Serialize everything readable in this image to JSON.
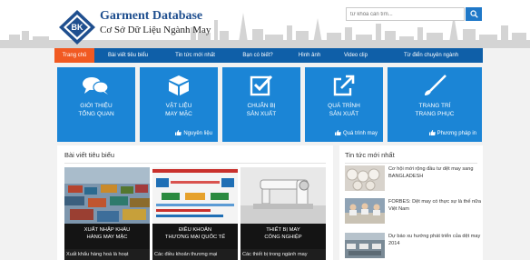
{
  "header": {
    "logo_text": "BK",
    "title": "Garment Database",
    "subtitle": "Cơ Sở Dữ Liệu Ngành May",
    "search_placeholder": "từ khóa cần tìm...",
    "search_icon": "search-icon"
  },
  "colors": {
    "nav_bg": "#0f5fa8",
    "nav_active": "#f15a22",
    "tile_bg": "#1b85d6",
    "title_blue": "#1f4f8f"
  },
  "nav": {
    "items": [
      {
        "label": "Trang chủ",
        "active": true
      },
      {
        "label": "Bài viết tiêu biểu",
        "active": false
      },
      {
        "label": "Tin tức mới nhất",
        "active": false
      },
      {
        "label": "Bạn có biết?",
        "active": false
      },
      {
        "label": "Hình ảnh",
        "active": false
      },
      {
        "label": "Video clip",
        "active": false
      },
      {
        "label": "Từ điển chuyên ngành",
        "active": false
      }
    ]
  },
  "tiles": [
    {
      "title_line1": "Giới thiệu",
      "title_line2": "tổng quan",
      "link": "",
      "icon": "chat-bubbles-icon"
    },
    {
      "title_line1": "Vật liệu",
      "title_line2": "may mặc",
      "link": "Nguyên liệu",
      "icon": "box-icon"
    },
    {
      "title_line1": "Chuẩn bị",
      "title_line2": "sản xuất",
      "link": "",
      "icon": "checkbox-icon"
    },
    {
      "title_line1": "Quá trình",
      "title_line2": "sản xuất",
      "link": "Quá trình may",
      "icon": "external-link-icon"
    },
    {
      "title_line1": "Trang trí",
      "title_line2": "trang phục",
      "link": "Phương pháp in",
      "icon": "brush-icon"
    }
  ],
  "featured": {
    "title": "Bài viết tiêu biểu",
    "cards": [
      {
        "caption_line1": "Xuất nhập khẩu",
        "caption_line2": "hàng may mặc",
        "excerpt": "Xuất khẩu hàng hoá là hoạt",
        "thumb": "port-containers-image"
      },
      {
        "caption_line1": "Điều khoản",
        "caption_line2": "thương mại quốc tế",
        "excerpt": "Các điều khoản thương mại",
        "thumb": "incoterms-diagram-image"
      },
      {
        "caption_line1": "Thiết bị may",
        "caption_line2": "công nghiệp",
        "excerpt": "Các thiết bị trong ngành may",
        "thumb": "sewing-machine-image"
      }
    ]
  },
  "news": {
    "title": "Tin tức mới nhất",
    "items": [
      {
        "text": "Cơ hội mới rộng đầu tư dệt may sang BANGLADESH",
        "thumb": "fabric-rolls-image"
      },
      {
        "text": "FORBES: Dệt may có thực sự là thế nữa Việt Nam",
        "thumb": "workers-sewing-image"
      },
      {
        "text": "Dự báo xu hướng phát triển của dệt may 2014",
        "thumb": "factory-floor-image"
      }
    ]
  }
}
